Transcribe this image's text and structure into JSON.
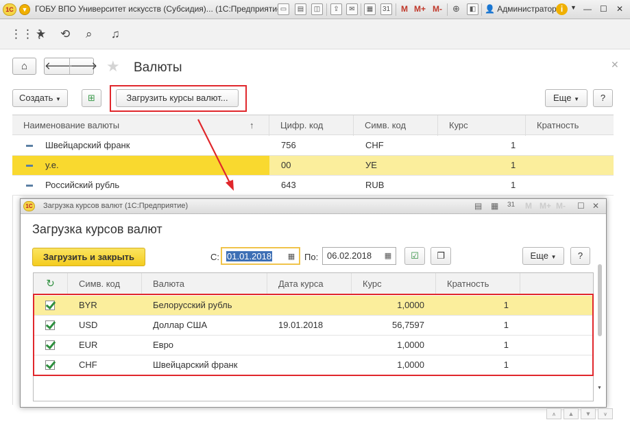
{
  "titlebar": {
    "logo": "1С",
    "title": "ГОБУ ВПО Университет искусств (Субсидия)... (1С:Предприятие)",
    "tools": [
      "М",
      "М+",
      "М-"
    ],
    "user": "Администратор"
  },
  "form": {
    "title": "Валюты",
    "create_label": "Создать",
    "load_rates_label": "Загрузить курсы валют...",
    "more_label": "Еще",
    "help_label": "?",
    "columns": [
      "Наименование валюты",
      "Цифр. код",
      "Симв. код",
      "Курс",
      "Кратность"
    ],
    "sort_arrow": "↑",
    "rows": [
      {
        "name": "Швейцарский франк",
        "digital": "756",
        "symbol": "CHF",
        "rate": "1",
        "ratio": ""
      },
      {
        "name": "у.е.",
        "digital": "00",
        "symbol": "УЕ",
        "rate": "1",
        "ratio": ""
      },
      {
        "name": "Российский рубль",
        "digital": "643",
        "symbol": "RUB",
        "rate": "1",
        "ratio": ""
      }
    ]
  },
  "dialog": {
    "window_title": "Загрузка курсов валют  (1С:Предприятие)",
    "title_tools": [
      "М",
      "М+",
      "М-"
    ],
    "heading": "Загрузка курсов валют",
    "load_close_label": "Загрузить и закрыть",
    "from_label": "С:",
    "from_value": "01.01.2018",
    "to_label": "По:",
    "to_value": "06.02.2018",
    "more_label": "Еще",
    "help_label": "?",
    "columns": [
      "Симв. код",
      "Валюта",
      "Дата курса",
      "Курс",
      "Кратность"
    ],
    "rows": [
      {
        "code": "BYR",
        "currency": "Белорусский рубль",
        "date": "",
        "rate": "1,0000",
        "ratio": "1"
      },
      {
        "code": "USD",
        "currency": "Доллар США",
        "date": "19.01.2018",
        "rate": "56,7597",
        "ratio": "1"
      },
      {
        "code": "EUR",
        "currency": "Евро",
        "date": "",
        "rate": "1,0000",
        "ratio": "1"
      },
      {
        "code": "CHF",
        "currency": "Швейцарский франк",
        "date": "",
        "rate": "1,0000",
        "ratio": "1"
      }
    ]
  },
  "colors": {
    "highlight_row": "#fbee9c",
    "selected_cell": "#f9d92f",
    "accent_red": "#e0262b",
    "primary_button": "#f4cc1f"
  }
}
